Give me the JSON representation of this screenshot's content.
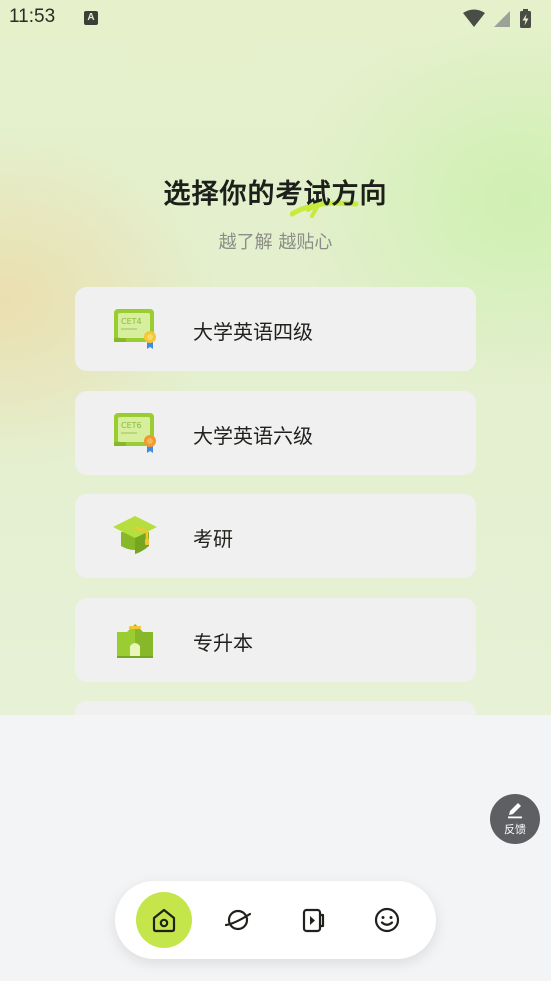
{
  "status_bar": {
    "time": "11:53",
    "notification_letter": "A",
    "icons": [
      "wifi-icon",
      "signal-icon",
      "battery-charging-icon"
    ]
  },
  "header": {
    "title": "选择你的考试方向",
    "subtitle": "越了解 越贴心"
  },
  "exam_options": [
    {
      "label": "大学英语四级",
      "icon": "cet4-certificate-icon",
      "badge": "CET4"
    },
    {
      "label": "大学英语六级",
      "icon": "cet6-certificate-icon",
      "badge": "CET6"
    },
    {
      "label": "考研",
      "icon": "graduation-cap-icon"
    },
    {
      "label": "专升本",
      "icon": "school-building-icon"
    }
  ],
  "feedback": {
    "label": "反馈",
    "icon": "pencil-icon"
  },
  "bottom_nav": {
    "items": [
      {
        "icon": "home-icon",
        "active": true
      },
      {
        "icon": "planet-icon",
        "active": false
      },
      {
        "icon": "video-icon",
        "active": false
      },
      {
        "icon": "smiley-icon",
        "active": false
      }
    ]
  },
  "colors": {
    "accent": "#c4e64a",
    "icon_green": "#9acd32",
    "card_background": "#f0f0f0",
    "title_text": "#1c1f1a",
    "subtitle_text": "#8a8e86"
  }
}
